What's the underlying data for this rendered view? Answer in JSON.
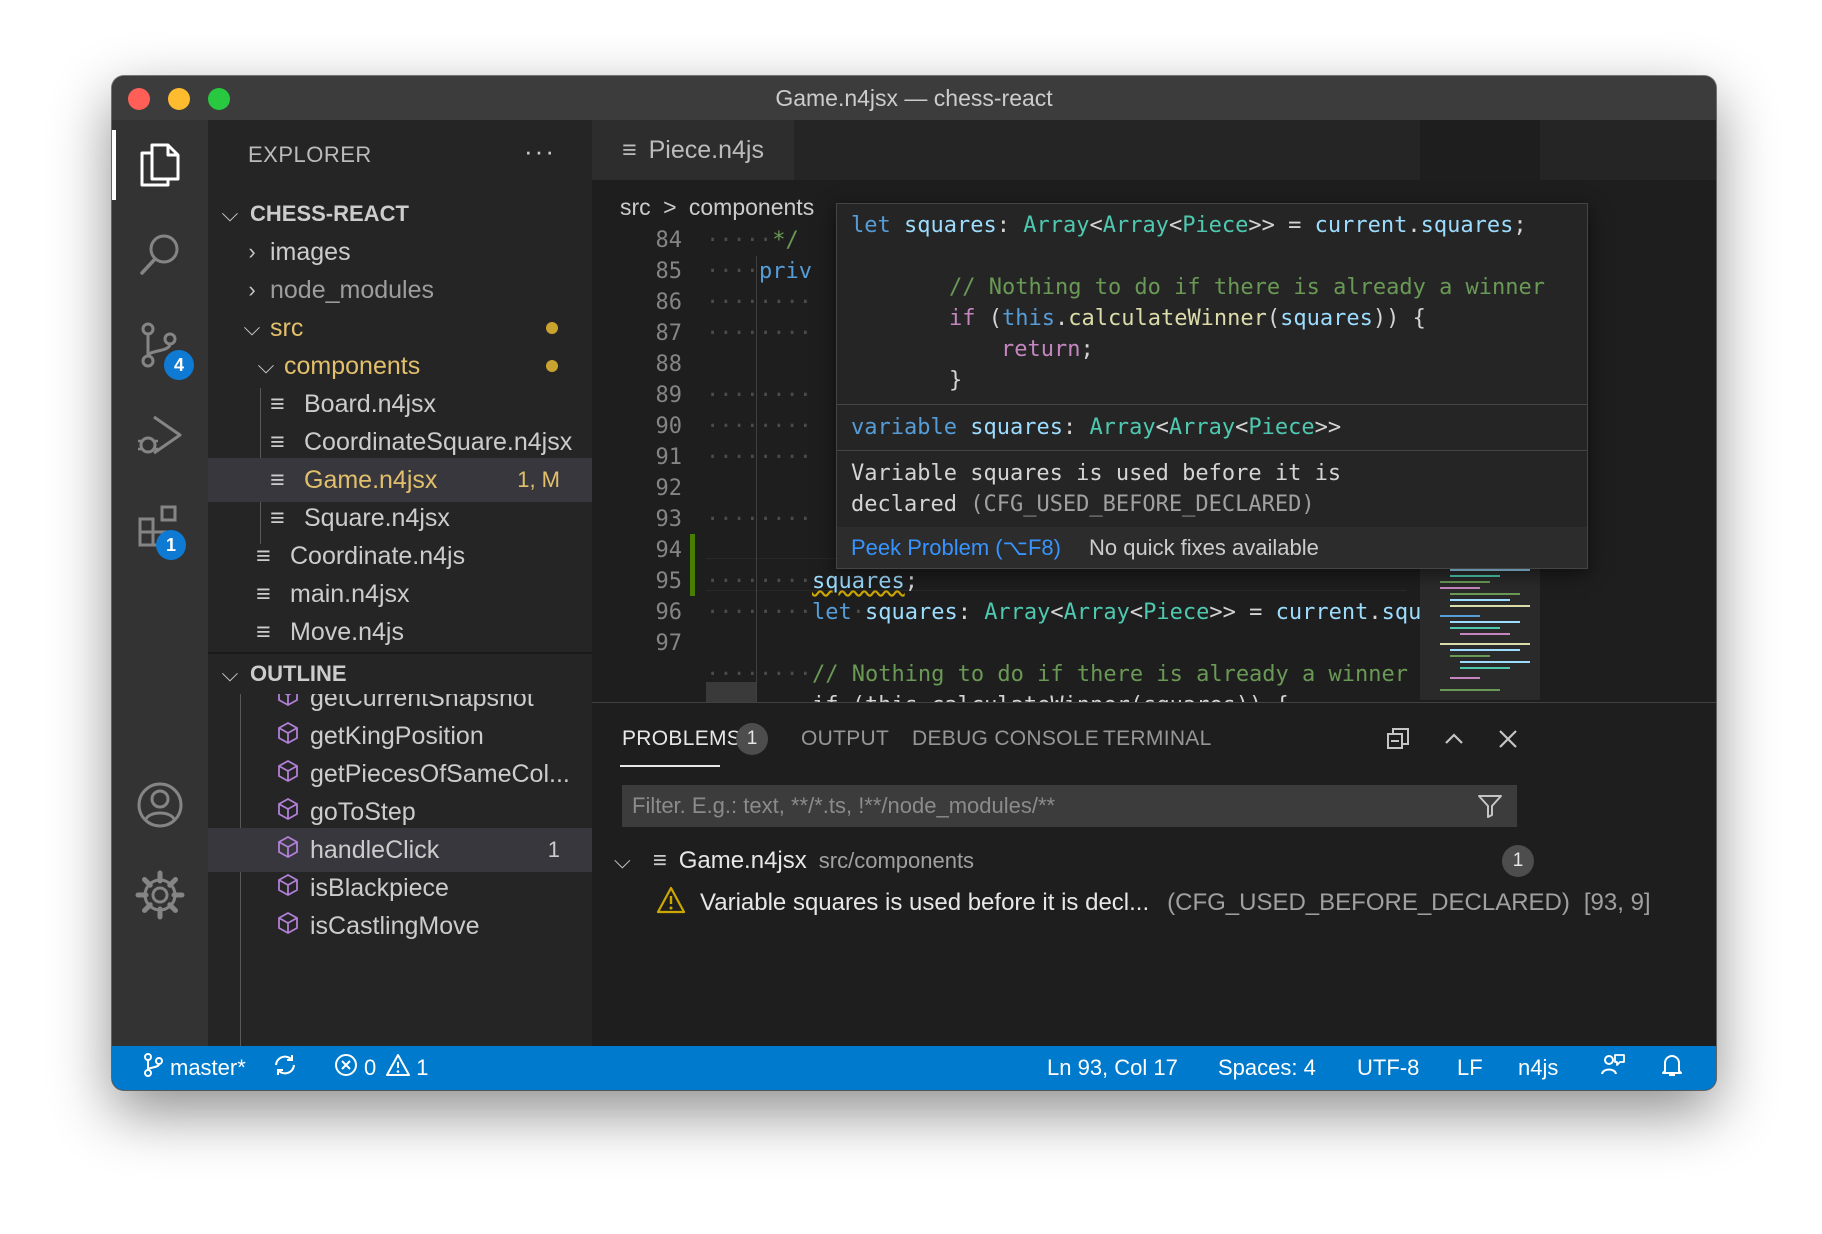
{
  "window": {
    "title": "Game.n4jsx — chess-react"
  },
  "activity": {
    "scm_badge": "4",
    "extensions_badge": "1"
  },
  "sidebar": {
    "explorer_label": "EXPLORER",
    "more_label": "···",
    "project": "CHESS-REACT",
    "tree": {
      "images": "images",
      "node_modules": "node_modules",
      "src": "src",
      "components": "components",
      "board": "Board.n4jsx",
      "coordsquare": "CoordinateSquare.n4jsx",
      "game": "Game.n4jsx",
      "game_meta": "1, M",
      "square": "Square.n4jsx",
      "coordinate": "Coordinate.n4js",
      "main": "main.n4jsx",
      "move": "Move.n4js"
    },
    "outline_label": "OUTLINE",
    "outline_items": [
      "getCurrentSnapshot",
      "getKingPosition",
      "getPiecesOfSameCol...",
      "goToStep",
      "handleClick",
      "isBlackpiece",
      "isCastlingMove"
    ],
    "outline_meta": "1"
  },
  "editor": {
    "tab_label": "Piece.n4js",
    "breadcrumb": {
      "src": "src",
      "sep": ">",
      "components": "components"
    },
    "line_numbers": [
      "84",
      "85",
      "86",
      "87",
      "88",
      "89",
      "90",
      "91",
      "92",
      "93",
      "94",
      "95",
      "96",
      "97"
    ],
    "code": {
      "l84": "*/",
      "l85": "priv",
      "l93_var": "squares",
      "l93_end": ";",
      "l94_let": "let",
      "l94_name": "squares",
      "l94_colon": ":",
      "l94_arr1": "Array",
      "l94_arr2": "Array",
      "l94_piece": "Piece",
      "l94_rest": ">> =",
      "l94_cur": "current",
      "l94_dot": ".",
      "l94_sq": "square",
      "l96_comment": "// Nothing to do if there is already a winner",
      "l97": "if (this.calculateWinner(squares)) {"
    }
  },
  "hover": {
    "code_line1": {
      "let": "let",
      "name": "squares",
      "colon": ":",
      "arr1": "Array",
      "arr2": "Array",
      "piece": "Piece",
      "eq": ">> =",
      "cur": "current",
      "dot": ".",
      "prop": "squares",
      "end": ";"
    },
    "code_line2": "// Nothing to do if there is already a winner",
    "code_line3": {
      "if": "if",
      "open": "(",
      "this": "this",
      "dot": ".",
      "fn": "calculateWinner",
      "p1": "(",
      "arg": "squares",
      "close": ")) {"
    },
    "code_line4": {
      "ret": "return",
      "semi": ";"
    },
    "code_line5": "}",
    "signature": {
      "kw": "variable",
      "name": "squares",
      "colon": ":",
      "arr1": "Array",
      "arr2": "Array",
      "piece": "Piece",
      "end": ">>"
    },
    "message_line1": "Variable squares is used before it is",
    "message_line2": "declared",
    "message_code": "(CFG_USED_BEFORE_DECLARED)",
    "peek_label": "Peek Problem (⌥F8)",
    "no_fixes": "No quick fixes available"
  },
  "panel": {
    "tabs": [
      "PROBLEMS",
      "OUTPUT",
      "DEBUG CONSOLE",
      "TERMINAL"
    ],
    "problems_count": "1",
    "filter_placeholder": "Filter. E.g.: text, **/*.ts, !**/node_modules/**",
    "file_name": "Game.n4jsx",
    "file_path": "src/components",
    "file_count": "1",
    "problem_text": "Variable squares is used before it is decl...",
    "problem_code": "(CFG_USED_BEFORE_DECLARED)",
    "problem_pos": "[93, 9]"
  },
  "statusbar": {
    "branch": "master*",
    "errors": "0",
    "warnings": "1",
    "position": "Ln 93, Col 17",
    "spaces": "Spaces: 4",
    "encoding": "UTF-8",
    "eol": "LF",
    "language": "n4js"
  },
  "colors": {
    "accent": "#007acc",
    "modified": "#e2c06b",
    "warning": "#cca700"
  }
}
